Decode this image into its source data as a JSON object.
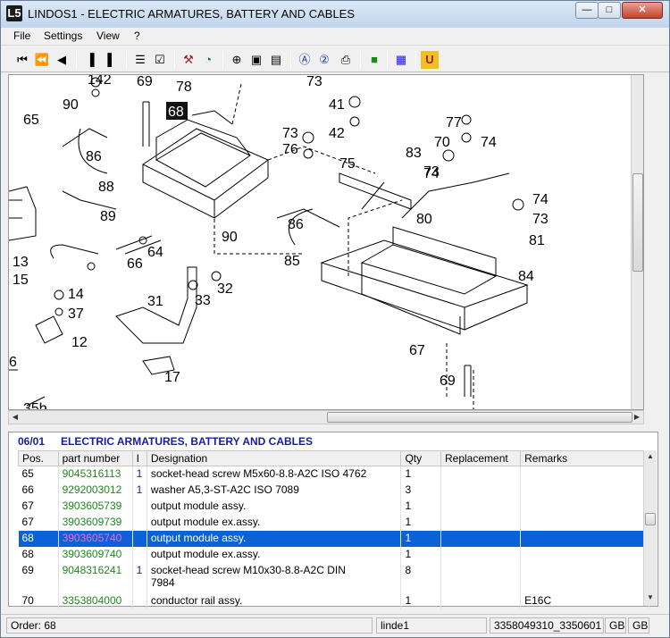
{
  "window": {
    "title": "LINDOS1 - ELECTRIC ARMATURES, BATTERY AND CABLES",
    "app_icon": "L5"
  },
  "menu": [
    "File",
    "Settings",
    "View",
    "?"
  ],
  "toolbar_icons": [
    "first-icon",
    "previous-chapter-icon",
    "previous-icon",
    "book-back-icon",
    "book-forward-icon",
    "cart-icon",
    "order-list-icon",
    "tools-icon",
    "globe-icon",
    "zoom-icon",
    "page-icon",
    "page-fit-icon",
    "info-a-icon",
    "help-icon",
    "print-icon",
    "green-book-icon",
    "blue-grid-icon",
    "u-icon"
  ],
  "drawing": {
    "selected_label": "68",
    "labels": [
      "142",
      "69",
      "78",
      "73",
      "65",
      "90",
      "86",
      "88",
      "89",
      "41",
      "42",
      "77",
      "74",
      "73",
      "76",
      "75",
      "83",
      "70",
      "74",
      "73",
      "74",
      "73",
      "86",
      "80",
      "81",
      "84",
      "90",
      "85",
      "64",
      "66",
      "13",
      "15",
      "14",
      "37",
      "12",
      "31",
      "33",
      "32",
      "17",
      "67",
      "69",
      "6",
      "35b"
    ]
  },
  "parts": {
    "section_code": "06/01",
    "section_title": "ELECTRIC ARMATURES, BATTERY AND CABLES",
    "columns": [
      "Pos.",
      "part number",
      "I",
      "Designation",
      "Qty",
      "Replacement",
      "Remarks"
    ],
    "rows": [
      {
        "pos": "65",
        "part_number": "9045316113",
        "idx": "1",
        "designation": "socket-head screw M5x60-8.8-A2C  ISO 4762",
        "qty": "1",
        "replacement": "",
        "remarks": ""
      },
      {
        "pos": "66",
        "part_number": "9292003012",
        "idx": "1",
        "designation": "washer A5,3-ST-A2C  ISO 7089",
        "qty": "3",
        "replacement": "",
        "remarks": ""
      },
      {
        "pos": "67",
        "part_number": "3903605739",
        "idx": "",
        "designation": "output module assy.",
        "qty": "1",
        "replacement": "",
        "remarks": ""
      },
      {
        "pos": "67",
        "part_number": "3903609739",
        "idx": "",
        "designation": "output module ex.assy.",
        "qty": "1",
        "replacement": "",
        "remarks": ""
      },
      {
        "pos": "68",
        "part_number": "3903605740",
        "idx": "",
        "designation": "output module assy.",
        "qty": "1",
        "replacement": "",
        "remarks": "",
        "selected": true
      },
      {
        "pos": "68",
        "part_number": "3903609740",
        "idx": "",
        "designation": "output module ex.assy.",
        "qty": "1",
        "replacement": "",
        "remarks": ""
      },
      {
        "pos": "69",
        "part_number": "9048316241",
        "idx": "1",
        "designation": "socket-head screw M10x30-8.8-A2C  DIN",
        "designation2": "7984",
        "qty": "8",
        "replacement": "",
        "remarks": ""
      },
      {
        "pos": "70",
        "part_number": "3353804000",
        "idx": "",
        "designation": "conductor rail assy.",
        "qty": "1",
        "replacement": "",
        "remarks": "E16C"
      }
    ]
  },
  "status": {
    "order": "Order: 68",
    "user": "linde1",
    "code": "3358049310_3350601",
    "lang1": "GB",
    "lang2": "GB"
  }
}
